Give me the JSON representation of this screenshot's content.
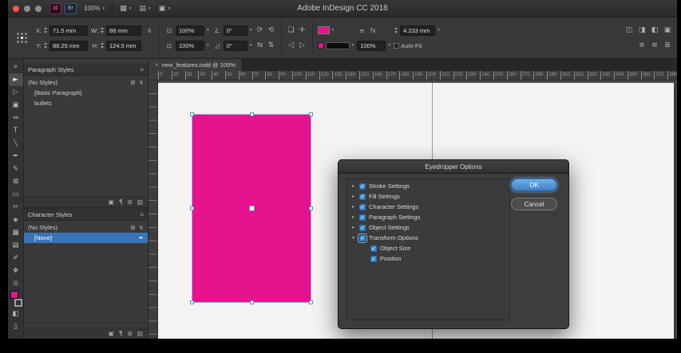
{
  "titlebar": {
    "app_title": "Adobe InDesign CC 2018",
    "zoom_value": "100%",
    "app_badge": "Id",
    "bridge_badge": "Br",
    "menu_controls": [
      {
        "name": "view-options-control",
        "glyph": "▦"
      },
      {
        "name": "screen-mode-control",
        "glyph": "▤"
      },
      {
        "name": "arrange-documents-control",
        "glyph": "▣"
      }
    ]
  },
  "control_panel": {
    "x_label": "X:",
    "x_value": "71.5 mm",
    "y_label": "Y:",
    "y_value": "88.25 mm",
    "w_label": "W:",
    "w_value": "88 mm",
    "h_label": "H:",
    "h_value": "124.5 mm",
    "scale_x_value": "100%",
    "scale_y_value": "100%",
    "rotation_value": "0°",
    "shear_value": "0°",
    "stroke_weight_value": "4.233 mm",
    "opacity_value": "100%",
    "autofit_label": "Auto-Fit",
    "right_icons_row1": [
      {
        "name": "text-wrap-none-icon",
        "glyph": "◫"
      },
      {
        "name": "text-wrap-around-icon",
        "glyph": "◨"
      },
      {
        "name": "corner-options-icon",
        "glyph": "◧"
      },
      {
        "name": "frame-fitting-icon",
        "glyph": "▣"
      }
    ],
    "right_icons_row2": [
      {
        "name": "align-icon",
        "glyph": "≡"
      },
      {
        "name": "distribute-icon",
        "glyph": "≡"
      },
      {
        "name": "object-styles-icon",
        "glyph": "≣"
      }
    ]
  },
  "document_tab": {
    "title": "new_features.indd @ 100%",
    "close_glyph": "×"
  },
  "h_ruler": {
    "ticks": [
      "0",
      "10",
      "20",
      "30",
      "40",
      "50",
      "60",
      "70",
      "80",
      "90",
      "100",
      "110",
      "120",
      "130",
      "140",
      "150",
      "160",
      "170",
      "180",
      "190",
      "200",
      "210",
      "220",
      "230",
      "240",
      "250",
      "260",
      "270",
      "280",
      "290",
      "300",
      "310",
      "320",
      "330",
      "340",
      "350",
      "360",
      "370",
      "380"
    ]
  },
  "toolbar": {
    "tools": [
      {
        "name": "toolbar-collapse",
        "glyph": "»"
      },
      {
        "name": "selection-tool",
        "glyph": "►",
        "active": true
      },
      {
        "name": "direct-selection-tool",
        "glyph": "▷"
      },
      {
        "name": "page-tool",
        "glyph": "▣"
      },
      {
        "name": "gap-tool",
        "glyph": "⇔"
      },
      {
        "name": "type-tool",
        "glyph": "T"
      },
      {
        "name": "line-tool",
        "glyph": "╲"
      },
      {
        "name": "pen-tool",
        "glyph": "✒"
      },
      {
        "name": "pencil-tool",
        "glyph": "✎"
      },
      {
        "name": "rectangle-frame-tool",
        "glyph": "⊠"
      },
      {
        "name": "rectangle-tool",
        "glyph": "▭"
      },
      {
        "name": "scissors-tool",
        "glyph": "✂"
      },
      {
        "name": "free-transform-tool",
        "glyph": "◈"
      },
      {
        "name": "gradient-tool",
        "glyph": "▩"
      },
      {
        "name": "note-tool",
        "glyph": "▤"
      },
      {
        "name": "eyedropper-tool",
        "glyph": "✐"
      },
      {
        "name": "hand-tool",
        "glyph": "✥"
      },
      {
        "name": "zoom-tool",
        "glyph": "⊙"
      },
      {
        "name": "fill-stroke-swatch",
        "glyph": "",
        "swatch": true
      },
      {
        "name": "apply-color",
        "glyph": "◧"
      },
      {
        "name": "screen-mode",
        "glyph": "▯"
      }
    ]
  },
  "paragraph_styles": {
    "title": "Paragraph Styles",
    "rows": [
      {
        "label": "(No Styles)",
        "icons": [
          {
            "name": "new-style-shortcut-icon",
            "glyph": "⊞"
          },
          {
            "name": "style-override-icon",
            "glyph": "↯"
          }
        ]
      },
      {
        "label": "[Basic Paragraph]",
        "indent": true
      },
      {
        "label": "bullets",
        "indent": true
      }
    ],
    "footer_icons": [
      {
        "name": "style-group-icon",
        "glyph": "▣"
      },
      {
        "name": "clear-overrides-icon",
        "glyph": "¶"
      },
      {
        "name": "create-style-icon",
        "glyph": "⊞"
      },
      {
        "name": "delete-style-icon",
        "glyph": "▥"
      }
    ]
  },
  "character_styles": {
    "title": "Character Styles",
    "rows": [
      {
        "label": "(No Styles)",
        "icons": [
          {
            "name": "new-style-shortcut-icon",
            "glyph": "⊞"
          },
          {
            "name": "style-override-icon",
            "glyph": "↯"
          }
        ]
      },
      {
        "label": "[None]",
        "indent": true,
        "selected": true,
        "icons": [
          {
            "name": "style-eyedropper-icon",
            "glyph": "✒"
          }
        ]
      }
    ],
    "footer_icons": [
      {
        "name": "style-group-icon",
        "glyph": "▣"
      },
      {
        "name": "clear-overrides-icon",
        "glyph": "¶"
      },
      {
        "name": "create-style-icon",
        "glyph": "⊞"
      },
      {
        "name": "delete-style-icon",
        "glyph": "▥"
      }
    ]
  },
  "dialog": {
    "title": "Eyedropper Options",
    "options": [
      {
        "label": "Stroke Settings",
        "checked": true,
        "disclosure": "collapsed"
      },
      {
        "label": "Fill Settings",
        "checked": true,
        "disclosure": "collapsed"
      },
      {
        "label": "Character Settings",
        "checked": true,
        "disclosure": "collapsed"
      },
      {
        "label": "Paragraph Settings",
        "checked": true,
        "disclosure": "collapsed"
      },
      {
        "label": "Object Settings",
        "checked": true,
        "disclosure": "collapsed"
      },
      {
        "label": "Transform Options",
        "checked": true,
        "disclosure": "expanded",
        "focused": true
      },
      {
        "label": "Object Size",
        "checked": true,
        "disclosure": "none",
        "child": true
      },
      {
        "label": "Position",
        "checked": true,
        "disclosure": "none",
        "child": true
      }
    ],
    "ok_label": "OK",
    "cancel_label": "Cancel"
  },
  "glyphs": {
    "panel_menu": "≡",
    "link_chain": "∞",
    "scale_icon": "⊡",
    "rotation_icon": "∠",
    "shear_icon": "◿",
    "rotate_cw": "⟳",
    "rotate_ccw": "⟲",
    "flip_h": "⇆",
    "flip_v": "⇅",
    "container_icon": "❏",
    "content_icon": "✛",
    "fx": "fx",
    "caret": "▾"
  },
  "colors": {
    "accent_pink": "#e7128d",
    "selection_blue": "#3a74b8",
    "checkbox_blue": "#3c8bd8",
    "ok_blue_top": "#6fb1ea",
    "ok_blue_bottom": "#3d7fc2",
    "frame_edge_blue": "#8ab2e8",
    "page_white": "#f4f3f1"
  }
}
